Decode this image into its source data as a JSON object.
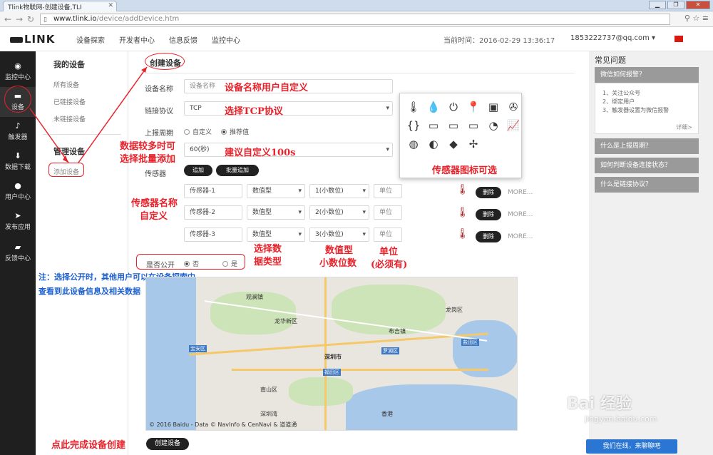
{
  "browser": {
    "tab_title": "Tlink物联网-创建设备,TLI",
    "url_host": "www.tlink.io",
    "url_path": "/device/addDevice.htm"
  },
  "header": {
    "logo": "LINK",
    "nav": [
      "设备探索",
      "开发者中心",
      "信息反馈",
      "监控中心"
    ],
    "current_time": "当前时间：2016-02-29 13:36:17",
    "user": "1853222737@qq.com ▾"
  },
  "sidebar": {
    "items": [
      {
        "label": "监控中心",
        "icon": "monitor-icon"
      },
      {
        "label": "设备",
        "icon": "device-icon"
      },
      {
        "label": "触发器",
        "icon": "bell-icon"
      },
      {
        "label": "数据下载",
        "icon": "download-icon"
      },
      {
        "label": "用户中心",
        "icon": "user-icon"
      },
      {
        "label": "发布应用",
        "icon": "publish-icon"
      },
      {
        "label": "反馈中心",
        "icon": "feedback-icon"
      }
    ]
  },
  "submenu": {
    "my_devices": "我的设备",
    "all_devices": "所有设备",
    "linked": "已链接设备",
    "unlinked": "未链接设备",
    "manage": "管理设备",
    "add_device": "添加设备"
  },
  "form": {
    "title": "创建设备",
    "name_label": "设备名称",
    "name_placeholder": "设备名称",
    "protocol_label": "链接协议",
    "protocol_value": "TCP",
    "period_label": "上报周期",
    "period_custom": "自定义",
    "period_recommended": "推荐值",
    "period_value": "60(秒)",
    "sensor_label": "传感器",
    "add_btn": "追加",
    "batch_btn": "批量追加",
    "sensors": [
      {
        "name": "传感器-1",
        "type": "数值型",
        "decimals": "1(小数位)",
        "unit": "单位"
      },
      {
        "name": "传感器-2",
        "type": "数值型",
        "decimals": "2(小数位)",
        "unit": "单位"
      },
      {
        "name": "传感器-3",
        "type": "数值型",
        "decimals": "3(小数位)",
        "unit": "单位"
      }
    ],
    "delete_label": "删除",
    "more_label": "MORE...",
    "public_label": "是否公开",
    "public_no": "否",
    "public_yes": "是",
    "create_btn": "创建设备"
  },
  "annotations": {
    "name_hint": "设备名称用户自定义",
    "protocol_hint": "选择TCP协议",
    "batch_hint_1": "数据较多时可",
    "batch_hint_2": "选择批量添加",
    "period_hint": "建议自定义100s",
    "sensor_icon_hint": "传感器图标可选",
    "sensor_name_hint_1": "传感器名称",
    "sensor_name_hint_2": "自定义",
    "type_hint_1": "选择数",
    "type_hint_2": "据类型",
    "decimal_hint_1": "数值型",
    "decimal_hint_2": "小数位数",
    "unit_hint_1": "单位",
    "unit_hint_2": "(必须有)",
    "public_note_1": "注：选择公开时，其他用户可以在设备探索中",
    "public_note_2": "查看到此设备信息及相关数据",
    "create_hint": "点此完成设备创建"
  },
  "map": {
    "labels": [
      "宝安区",
      "深圳市",
      "福田区",
      "罗湖区",
      "盐田区",
      "龙华新区",
      "南山区",
      "布吉镇",
      "观澜镇",
      "深圳湾",
      "香港",
      "龙岗区"
    ],
    "copyright": "© 2016 Baidu - Data © NavInfo & CenNavi & 道道通"
  },
  "faq": {
    "title": "常见问题",
    "q1": "微信如何报警？",
    "steps": [
      "1、关注公众号",
      "2、绑定用户",
      "3、触发器设置为微信报警"
    ],
    "detail": "详细>",
    "q2": "什么是上报周期？",
    "q3": "如何判断设备连接状态？",
    "q4": "什么是链接协议？"
  },
  "chat": "我们在线，来聊聊吧",
  "watermark": "Bai 经验",
  "watermark_sub": "jingyan.baidu.com"
}
